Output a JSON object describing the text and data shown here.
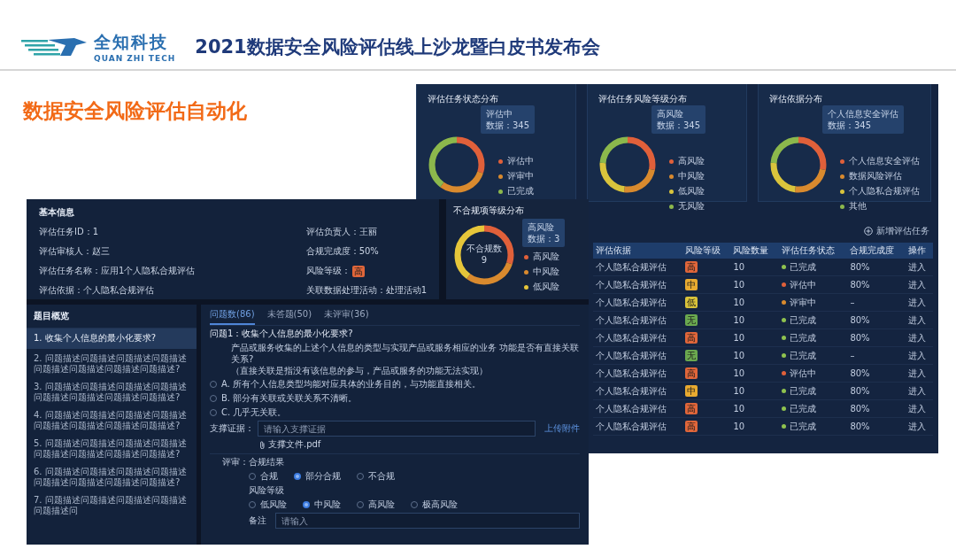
{
  "header": {
    "logo_name": "全知科技",
    "logo_subtitle": "QUAN ZHI TECH",
    "title": "2021数据安全风险评估线上沙龙暨白皮书发布会"
  },
  "heading": "数据安全风险评估自动化",
  "dashboard": {
    "charts": [
      {
        "title": "评估任务状态分布",
        "tooltip": [
          "评估中",
          "数据：345"
        ],
        "legend": [
          {
            "label": "评估中",
            "color": "#e0603a"
          },
          {
            "label": "评审中",
            "color": "#d98a2e"
          },
          {
            "label": "已完成",
            "color": "#8cb84c"
          }
        ]
      },
      {
        "title": "评估任务风险等级分布",
        "tooltip": [
          "高风险",
          "数据：345"
        ],
        "legend": [
          {
            "label": "高风险",
            "color": "#e0603a"
          },
          {
            "label": "中风险",
            "color": "#d98a2e"
          },
          {
            "label": "低风险",
            "color": "#d9c43c"
          },
          {
            "label": "无风险",
            "color": "#8cb84c"
          }
        ]
      },
      {
        "title": "评估依据分布",
        "tooltip": [
          "个人信息安全评估",
          "数据：345"
        ],
        "legend": [
          {
            "label": "个人信息安全评估",
            "color": "#e0603a"
          },
          {
            "label": "数据风险评估",
            "color": "#d98a2e"
          },
          {
            "label": "个人隐私合规评估",
            "color": "#d9c43c"
          },
          {
            "label": "其他",
            "color": "#8cb84c"
          }
        ]
      }
    ],
    "add_button": "新增评估任务",
    "table": {
      "columns": [
        "评估依据",
        "风险等级",
        "风险数量",
        "评估任务状态",
        "合规完成度",
        "操作"
      ],
      "rows": [
        {
          "basis": "个人隐私合规评估",
          "risk": {
            "text": "高",
            "color": "#e0663a"
          },
          "count": "10",
          "status": {
            "text": "已完成",
            "color": "#8fc24f"
          },
          "completion": "80%",
          "action": "进入"
        },
        {
          "basis": "个人隐私合规评估",
          "risk": {
            "text": "中",
            "color": "#e8aa30"
          },
          "count": "10",
          "status": {
            "text": "评估中",
            "color": "#e0603a"
          },
          "completion": "80%",
          "action": "进入"
        },
        {
          "basis": "个人隐私合规评估",
          "risk": {
            "text": "低",
            "color": "#d8c23a"
          },
          "count": "10",
          "status": {
            "text": "评审中",
            "color": "#d98a2e"
          },
          "completion": "–",
          "action": "进入"
        },
        {
          "basis": "个人隐私合规评估",
          "risk": {
            "text": "无",
            "color": "#6aa84f"
          },
          "count": "10",
          "status": {
            "text": "已完成",
            "color": "#8fc24f"
          },
          "completion": "80%",
          "action": "进入"
        },
        {
          "basis": "个人隐私合规评估",
          "risk": {
            "text": "高",
            "color": "#e0663a"
          },
          "count": "10",
          "status": {
            "text": "已完成",
            "color": "#8fc24f"
          },
          "completion": "80%",
          "action": "进入"
        },
        {
          "basis": "个人隐私合规评估",
          "risk": {
            "text": "无",
            "color": "#6aa84f"
          },
          "count": "10",
          "status": {
            "text": "已完成",
            "color": "#8fc24f"
          },
          "completion": "–",
          "action": "进入"
        },
        {
          "basis": "个人隐私合规评估",
          "risk": {
            "text": "高",
            "color": "#e0663a"
          },
          "count": "10",
          "status": {
            "text": "评估中",
            "color": "#e0603a"
          },
          "completion": "80%",
          "action": "进入"
        },
        {
          "basis": "个人隐私合规评估",
          "risk": {
            "text": "中",
            "color": "#e8aa30"
          },
          "count": "10",
          "status": {
            "text": "已完成",
            "color": "#8fc24f"
          },
          "completion": "80%",
          "action": "进入"
        },
        {
          "basis": "个人隐私合规评估",
          "risk": {
            "text": "高",
            "color": "#e0663a"
          },
          "count": "10",
          "status": {
            "text": "已完成",
            "color": "#8fc24f"
          },
          "completion": "80%",
          "action": "进入"
        },
        {
          "basis": "个人隐私合规评估",
          "risk": {
            "text": "高",
            "color": "#e0663a"
          },
          "count": "10",
          "status": {
            "text": "已完成",
            "color": "#8fc24f"
          },
          "completion": "80%",
          "action": "进入"
        }
      ]
    }
  },
  "detail": {
    "basic_info": {
      "title": "基本信息",
      "left": [
        {
          "text": "评估任务ID：1"
        },
        {
          "text": "评估审核人：赵三"
        },
        {
          "text": "评估任务名称：应用1个人隐私合规评估"
        },
        {
          "text": "评估依据：个人隐私合规评估"
        }
      ],
      "right": [
        {
          "text": "评估负责人：王丽"
        },
        {
          "text": "合规完成度：50%"
        },
        {
          "text": "风险等级：",
          "badge": {
            "text": "高",
            "color": "#e0663a"
          }
        },
        {
          "text": "关联数据处理活动：处理活动1"
        }
      ]
    },
    "noncompliance_chart": {
      "title": "不合规项等级分布",
      "tooltip": [
        "高风险",
        "数据：3"
      ],
      "center": [
        "不合规数",
        "9"
      ],
      "legend": [
        {
          "label": "高风险",
          "color": "#e0603a"
        },
        {
          "label": "中风险",
          "color": "#d98a2e"
        },
        {
          "label": "低风险",
          "color": "#e6c63a"
        }
      ]
    },
    "question_list": {
      "title": "题目概览",
      "items": [
        {
          "text": "1. 收集个人信息的最小化要求?",
          "selected": true
        },
        {
          "text": "2. 问题描述问题描述问题描述问题描述问题描述问题描述问题描述问题描述?",
          "selected": false
        },
        {
          "text": "3. 问题描述问题描述问题描述问题描述问题描述问题描述问题描述问题描述?",
          "selected": false
        },
        {
          "text": "4. 问题描述问题描述问题描述问题描述问题描述问题描述问题描述问题描述?",
          "selected": false
        },
        {
          "text": "5. 问题描述问题描述问题描述问题描述问题描述问题描述问题描述问题描述?",
          "selected": false
        },
        {
          "text": "6. 问题描述问题描述问题描述问题描述问题描述问题描述问题描述问题描述?",
          "selected": false
        },
        {
          "text": "7. 问题描述问题描述问题描述问题描述问题描述问",
          "selected": false
        }
      ]
    },
    "tabs": [
      {
        "label": "问题数(86)",
        "selected": true
      },
      {
        "label": "未答题(50)",
        "selected": false
      },
      {
        "label": "未评审(36)",
        "selected": false
      }
    ],
    "question": {
      "title": "问题1：收集个人信息的最小化要求?",
      "body": [
        "产品或服务收集的上述个人信息的类型与实现产品或服务相应的业务 功能是否有直接关联关系?",
        "（直接关联是指没有该信息的参与，产品或服务的功能无法实现）"
      ],
      "options": [
        {
          "text": "A. 所有个人信息类型均能对应具体的业务目的，与功能直接相关。",
          "selected": false
        },
        {
          "text": "B. 部分有关联或关联关系不清晰。",
          "selected": false
        },
        {
          "text": "C. 几乎无关联。",
          "selected": false
        }
      ]
    },
    "evidence": {
      "label": "支撑证据：",
      "placeholder": "请输入支撑证据",
      "upload": "上传附件",
      "file": "支撑文件.pdf"
    },
    "review": {
      "label": "评审：",
      "result_label": "合规结果",
      "results": [
        {
          "label": "合规",
          "selected": false
        },
        {
          "label": "部分合规",
          "selected": true
        },
        {
          "label": "不合规",
          "selected": false
        }
      ],
      "risk_label": "风险等级",
      "risks": [
        {
          "label": "低风险",
          "selected": false
        },
        {
          "label": "中风险",
          "selected": true
        },
        {
          "label": "高风险",
          "selected": false
        },
        {
          "label": "极高风险",
          "selected": false
        }
      ],
      "note_label": "备注",
      "note_placeholder": "请输入"
    }
  }
}
